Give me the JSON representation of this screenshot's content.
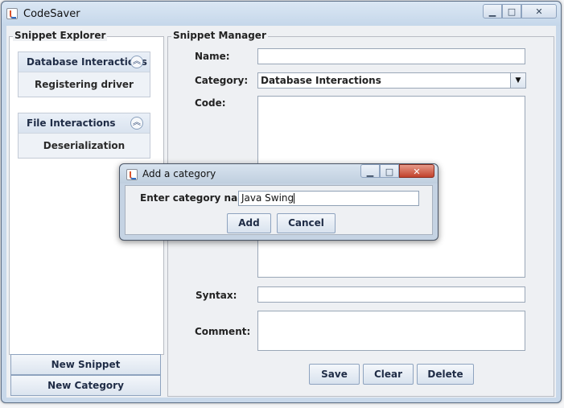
{
  "window": {
    "title": "CodeSaver"
  },
  "explorer": {
    "title": "Snippet Explorer",
    "categories": [
      {
        "name": "Database Interactions",
        "items": [
          "Registering driver"
        ]
      },
      {
        "name": "File Interactions",
        "items": [
          "Deserialization"
        ]
      }
    ],
    "new_snippet_label": "New Snippet",
    "new_category_label": "New Category"
  },
  "manager": {
    "title": "Snippet Manager",
    "name_label": "Name:",
    "name_value": "",
    "category_label": "Category:",
    "category_value": "Database Interactions",
    "code_label": "Code:",
    "syntax_label": "Syntax:",
    "syntax_value": "",
    "comment_label": "Comment:",
    "save_label": "Save",
    "clear_label": "Clear",
    "delete_label": "Delete"
  },
  "dialog": {
    "title": "Add a category",
    "prompt": "Enter category name",
    "input_value": "Java Swing",
    "add_label": "Add",
    "cancel_label": "Cancel"
  },
  "icons": {
    "minimize": "minimize-icon",
    "maximize": "maximize-icon",
    "close": "close-icon",
    "collapse": "collapse-chevron-icon",
    "dropdown": "chevron-down-icon"
  }
}
